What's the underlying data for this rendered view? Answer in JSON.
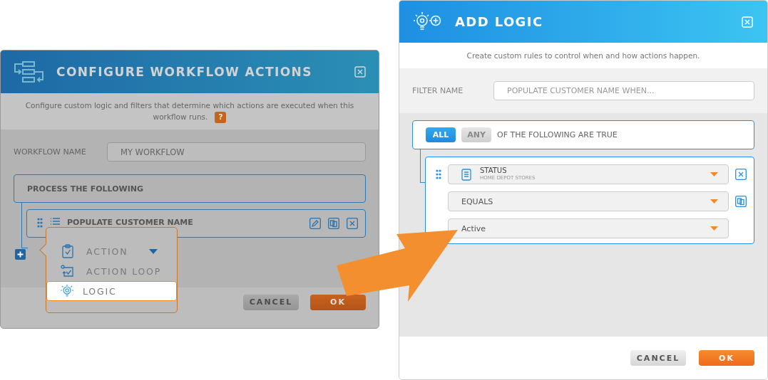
{
  "left_dialog": {
    "title": "CONFIGURE WORKFLOW ACTIONS",
    "description": "Configure custom logic and filters that determine which actions are executed when this workflow runs.",
    "help_badge": "?",
    "name_label": "WORKFLOW NAME",
    "name_value": "MY WORKFLOW",
    "group_title": "PROCESS THE FOLLOWING",
    "actions": [
      {
        "label": "POPULATE CUSTOMER NAME"
      }
    ],
    "buttons": [
      {
        "label": "CANCEL",
        "kind": "secondary"
      },
      {
        "label": "OK",
        "kind": "primary"
      }
    ]
  },
  "add_menu": {
    "items": [
      {
        "kind": "action",
        "label": "ACTION",
        "has_caret": true,
        "selected": false
      },
      {
        "kind": "loop",
        "label": "ACTION LOOP",
        "has_caret": false,
        "selected": false
      },
      {
        "kind": "logic",
        "label": "LOGIC",
        "has_caret": false,
        "selected": true
      }
    ]
  },
  "right_dialog": {
    "title": "ADD LOGIC",
    "description": "Create custom rules to control when and how actions happen.",
    "filter_label": "FILTER NAME",
    "filter_placeholder": "POPULATE CUSTOMER NAME WHEN...",
    "match": [
      {
        "label": "ALL",
        "selected": true
      },
      {
        "label": "ANY",
        "selected": false
      }
    ],
    "match_text": "OF THE FOLLOWING ARE TRUE",
    "condition": {
      "field": "STATUS",
      "field_source": "HOME DEPOT STORES",
      "operator": "EQUALS",
      "value": "Active"
    },
    "buttons": [
      {
        "label": "CANCEL",
        "kind": "secondary"
      },
      {
        "label": "OK",
        "kind": "primary"
      }
    ]
  }
}
